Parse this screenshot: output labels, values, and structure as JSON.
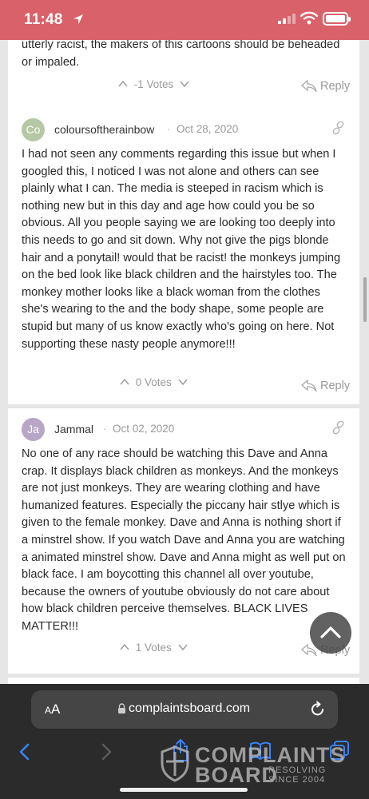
{
  "status_bar": {
    "time": "11:48",
    "accent": "#d9616a"
  },
  "comments": [
    {
      "text": "utterly racist, the makers of this cartoons should be beheaded or impaled.",
      "votes": "-1 Votes",
      "reply": "Reply"
    },
    {
      "avatar_initials": "Co",
      "avatar_color": "#b5c7a3",
      "author": "coloursoftherainbow",
      "separator": "·",
      "date": "Oct 28, 2020",
      "text": "I had not seen any comments regarding this issue but when I googled this, I noticed I was not alone and others can see plainly what I can. The media is steeped in racism which is nothing new but in this day and age how could you be so obvious. All you people saying we are looking too deeply into this needs to go and sit down. Why not give the pigs blonde hair and a ponytail! would that be racist! the monkeys jumping on the bed look like black children and the hairstyles too. The monkey mother looks like a black woman from the clothes she's wearing to the and the body shape, some people are stupid but many of us know exactly who's going on here. Not supporting these nasty people anymore!!!",
      "votes": "0 Votes",
      "reply": "Reply"
    },
    {
      "avatar_initials": "Ja",
      "avatar_color": "#b7a6c6",
      "author": "Jammal",
      "separator": "·",
      "date": "Oct 02, 2020",
      "text": "No one of any race should be watching this Dave and Anna crap. It displays black children as monkeys. And the monkeys are not just monkeys. They are wearing clothing and have humanized features. Especially the piccany hair stlye which is given to the female monkey. Dave and Anna is nothing short if a minstrel show. If you watch Dave and Anna you are watching a animated minstrel show. Dave and Anna might as well put on black face. I am boycotting this channel all over youtube, because the owners of youtube obviously do not care about how black children perceive themselves. BLACK LIVES MATTER!!!",
      "votes": "1 Votes",
      "reply": "Reply"
    }
  ],
  "browser": {
    "aa_label": "AA",
    "url": "complaintsboard.com"
  },
  "watermark": {
    "line1": "COMPLAINTS",
    "line2": "BOARD",
    "sub1": "RESOLVING",
    "sub2": "SINCE 2004"
  }
}
